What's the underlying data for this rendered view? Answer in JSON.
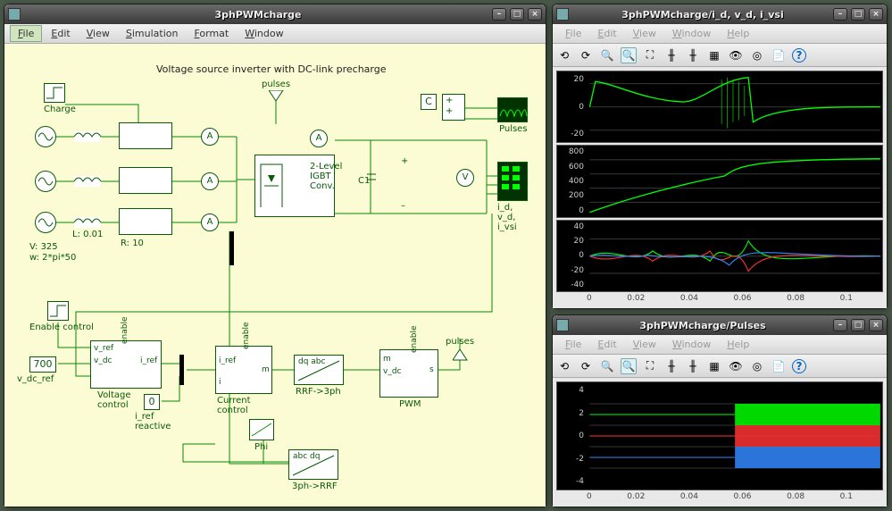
{
  "windows": {
    "model": {
      "title": "3phPWMcharge",
      "menubar": [
        "File",
        "Edit",
        "View",
        "Simulation",
        "Format",
        "Window"
      ],
      "diagram_title": "Voltage source inverter with DC-link precharge",
      "labels": {
        "charge": "Charge",
        "L": "L: 0.01",
        "R": "R: 10",
        "Vsrc": "V: 325",
        "wsrc": "w: 2*pi*50",
        "pulses_top": "pulses",
        "pulses_right": "Pulses",
        "C_top": "C",
        "C1": "C1",
        "converter": "2-Level IGBT Conv.",
        "sig_out": "i_d, v_d, i_vsi",
        "enable_ctrl": "Enable control",
        "vdc_ref": "700",
        "vdc_ref_lbl": "v_dc_ref",
        "vref": "v_ref",
        "vdc": "v_dc",
        "enable": "enable",
        "iref": "i_ref",
        "m": "m",
        "voltage_ctrl": "Voltage control",
        "iref_reactive_val": "0",
        "iref_reactive_lbl": "i_ref reactive",
        "current_ctrl": "Current control",
        "phi": "Phi",
        "rrf3ph": "RRF->3ph",
        "ph3rrf": "3ph->RRF",
        "dq_abc": "dq abc",
        "abc_dq": "abc dq",
        "pwm": "PWM",
        "pwm_m": "m",
        "pwm_vdc": "v_dc",
        "pwm_enable": "enable",
        "pwm_s": "s",
        "pulses_lbl": "pulses",
        "A": "A",
        "V": "V"
      }
    },
    "scope1": {
      "title": "3phPWMcharge/i_d, v_d, i_vsi",
      "menubar": [
        "File",
        "Edit",
        "View",
        "Window",
        "Help"
      ],
      "plots": [
        {
          "ylabels": [
            "20",
            "0",
            "-20"
          ]
        },
        {
          "ylabels": [
            "800",
            "600",
            "400",
            "200",
            "0"
          ]
        },
        {
          "ylabels": [
            "40",
            "20",
            "0",
            "-20",
            "-40"
          ]
        }
      ],
      "xlabels": [
        "0",
        "0.02",
        "0.04",
        "0.06",
        "0.08",
        "0.1"
      ]
    },
    "scope2": {
      "title": "3phPWMcharge/Pulses",
      "menubar": [
        "File",
        "Edit",
        "View",
        "Window",
        "Help"
      ],
      "plot": {
        "ylabels": [
          "4",
          "2",
          "0",
          "-2",
          "-4"
        ]
      },
      "xlabels": [
        "0",
        "0.02",
        "0.04",
        "0.06",
        "0.08",
        "0.1"
      ]
    }
  },
  "icons": {
    "minimize": "–",
    "maximize": "□",
    "close": "×",
    "back": "⟲",
    "fwd": "⟳",
    "zoom": "🔍",
    "zoombox": "🔲",
    "fit": "⛶",
    "cursor": "╫",
    "grid": "▦",
    "eye": "👁",
    "target": "◎",
    "page": "📄",
    "help": "?"
  }
}
